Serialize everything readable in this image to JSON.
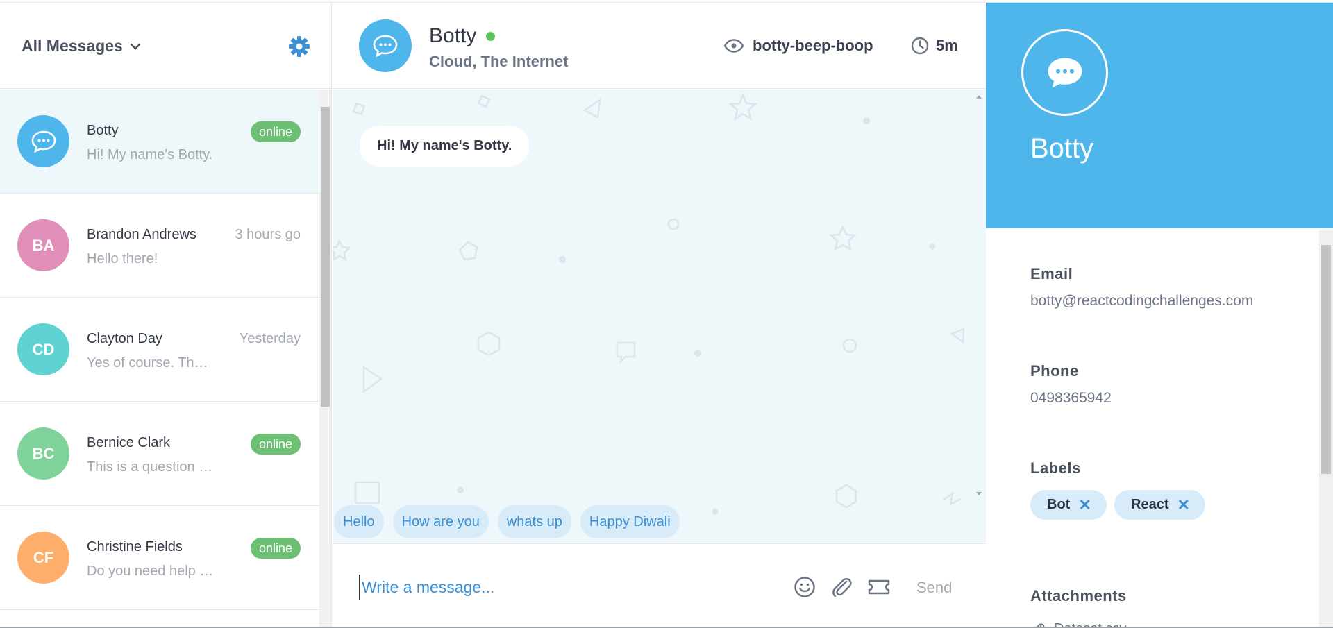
{
  "sidebar": {
    "filter_label": "All Messages",
    "conversations": [
      {
        "name": "Botty",
        "preview": "Hi! My name's Botty.",
        "meta": "online",
        "initials": "",
        "color": "#4fb6ec"
      },
      {
        "name": "Brandon Andrews",
        "preview": "Hello there!",
        "meta": "3 hours go",
        "initials": "BA",
        "color": "#e08fba"
      },
      {
        "name": "Clayton Day",
        "preview": "Yes of course. Tha…",
        "meta": "Yesterday",
        "initials": "CD",
        "color": "#5fd2d2"
      },
      {
        "name": "Bernice Clark",
        "preview": "This is a question r…",
        "meta": "online",
        "initials": "BC",
        "color": "#7fd39a"
      },
      {
        "name": "Christine Fields",
        "preview": "Do you need help …",
        "meta": "online",
        "initials": "CF",
        "color": "#fcae6a"
      }
    ]
  },
  "chat": {
    "title": "Botty",
    "subtitle": "Cloud, The Internet",
    "username": "botty-beep-boop",
    "time": "5m",
    "messages": [
      {
        "text": "Hi! My name's Botty."
      }
    ],
    "quick_replies": [
      "Hello",
      "How are you",
      "whats up",
      "Happy Diwali"
    ],
    "composer": {
      "placeholder": "Write a message...",
      "send_label": "Send"
    }
  },
  "details": {
    "name": "Botty",
    "email_label": "Email",
    "email": "botty@reactcodingchallenges.com",
    "phone_label": "Phone",
    "phone": "0498365942",
    "labels_label": "Labels",
    "labels": [
      "Bot",
      "React"
    ],
    "remove_glyph": "✕",
    "attachments_label": "Attachments",
    "attachment_partial": "Dataset.csv"
  },
  "colors": {
    "accent": "#4fb6ec",
    "online": "#6dbf73",
    "chip_bg": "#d7ebf8",
    "chat_bg": "#eef7fa"
  },
  "icons": [
    "chevron-down-icon",
    "gear-icon",
    "chat-bubble-icon",
    "eye-icon",
    "clock-icon",
    "emoji-icon",
    "paperclip-icon",
    "ticket-icon",
    "close-icon"
  ]
}
